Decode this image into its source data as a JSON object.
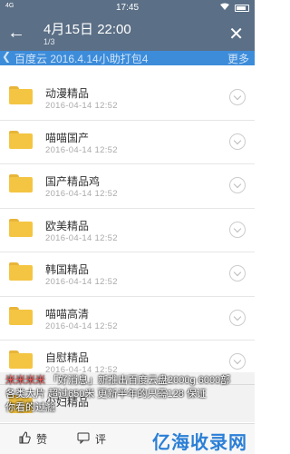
{
  "status_bar": {
    "left_text": "4G",
    "time": "17:45"
  },
  "header": {
    "title": "4月15日 22:00",
    "subtitle": "1/3",
    "path_text": "百度云 2016.4.14小助打包4",
    "more_label": "更多"
  },
  "folders": [
    {
      "name": "动漫精品",
      "date": "2016-04-14 12:52"
    },
    {
      "name": "喵喵国产",
      "date": "2016-04-14 12:52"
    },
    {
      "name": "国产精品鸡",
      "date": "2016-04-14 12:52"
    },
    {
      "name": "欧美精品",
      "date": "2016-04-14 12:52"
    },
    {
      "name": "韩国精品",
      "date": "2016-04-14 12:52"
    },
    {
      "name": "喵喵高清",
      "date": "2016-04-14 12:52"
    },
    {
      "name": "自慰精品",
      "date": "2016-04-14 12:52"
    },
    {
      "name": "少妇精品",
      "date": ""
    }
  ],
  "overlay": {
    "prefix": "米米米米",
    "line1_rest": "「好消息」新推出百度云盘2000g 6000部",
    "line2": "各类大片 超过650米 更新半年的只需128 保证",
    "line3": "你看的过瘾"
  },
  "bottom_bar": {
    "like_label": "赞",
    "comment_label": "评",
    "watermark": "亿海收录网"
  },
  "colors": {
    "header_bg": "#5b6f86",
    "path_bar_bg": "#3d8cda",
    "folder": "#f4c542"
  }
}
